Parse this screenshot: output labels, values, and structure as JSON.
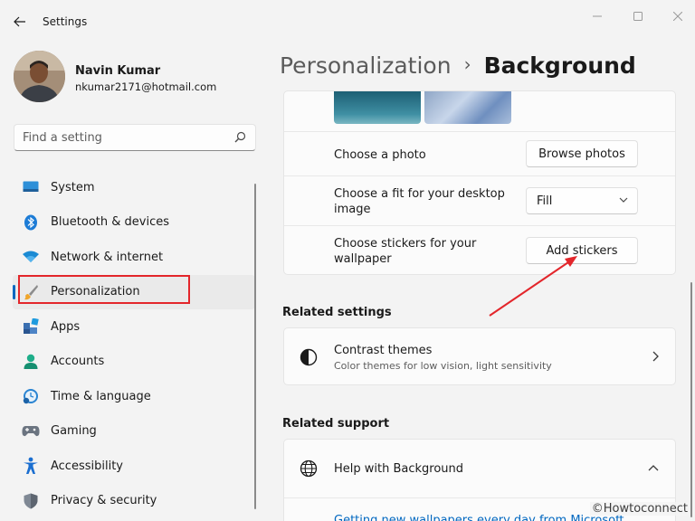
{
  "window": {
    "title": "Settings",
    "controls": [
      "minimize",
      "maximize",
      "close"
    ]
  },
  "profile": {
    "name": "Navin Kumar",
    "email": "nkumar2171@hotmail.com"
  },
  "search": {
    "placeholder": "Find a setting"
  },
  "sidebar": {
    "items": [
      {
        "label": "System",
        "icon": "system-icon"
      },
      {
        "label": "Bluetooth & devices",
        "icon": "bluetooth-icon"
      },
      {
        "label": "Network & internet",
        "icon": "wifi-icon"
      },
      {
        "label": "Personalization",
        "icon": "brush-icon",
        "selected": true
      },
      {
        "label": "Apps",
        "icon": "apps-icon"
      },
      {
        "label": "Accounts",
        "icon": "person-icon"
      },
      {
        "label": "Time & language",
        "icon": "clock-globe-icon"
      },
      {
        "label": "Gaming",
        "icon": "gamepad-icon"
      },
      {
        "label": "Accessibility",
        "icon": "accessibility-icon"
      },
      {
        "label": "Privacy & security",
        "icon": "shield-icon"
      }
    ]
  },
  "header": {
    "parent": "Personalization",
    "separator": "›",
    "current": "Background"
  },
  "background_card": {
    "rows": [
      {
        "label": "Choose a photo",
        "control": "button",
        "value": "Browse photos"
      },
      {
        "label": "Choose a fit for your desktop image",
        "control": "dropdown",
        "value": "Fill"
      },
      {
        "label": "Choose stickers for your wallpaper",
        "control": "button",
        "value": "Add stickers"
      }
    ]
  },
  "related_settings": {
    "title": "Related settings",
    "contrast": {
      "title": "Contrast themes",
      "subtitle": "Color themes for low vision, light sensitivity"
    }
  },
  "related_support": {
    "title": "Related support",
    "help": {
      "title": "Help with Background",
      "link": "Getting new wallpapers every day from Microsoft"
    }
  },
  "watermark": "©Howtoconnect",
  "colors": {
    "accent": "#0067c0",
    "annotation_red": "#e3262b",
    "background": "#f3f3f3",
    "card": "#fbfbfb"
  }
}
